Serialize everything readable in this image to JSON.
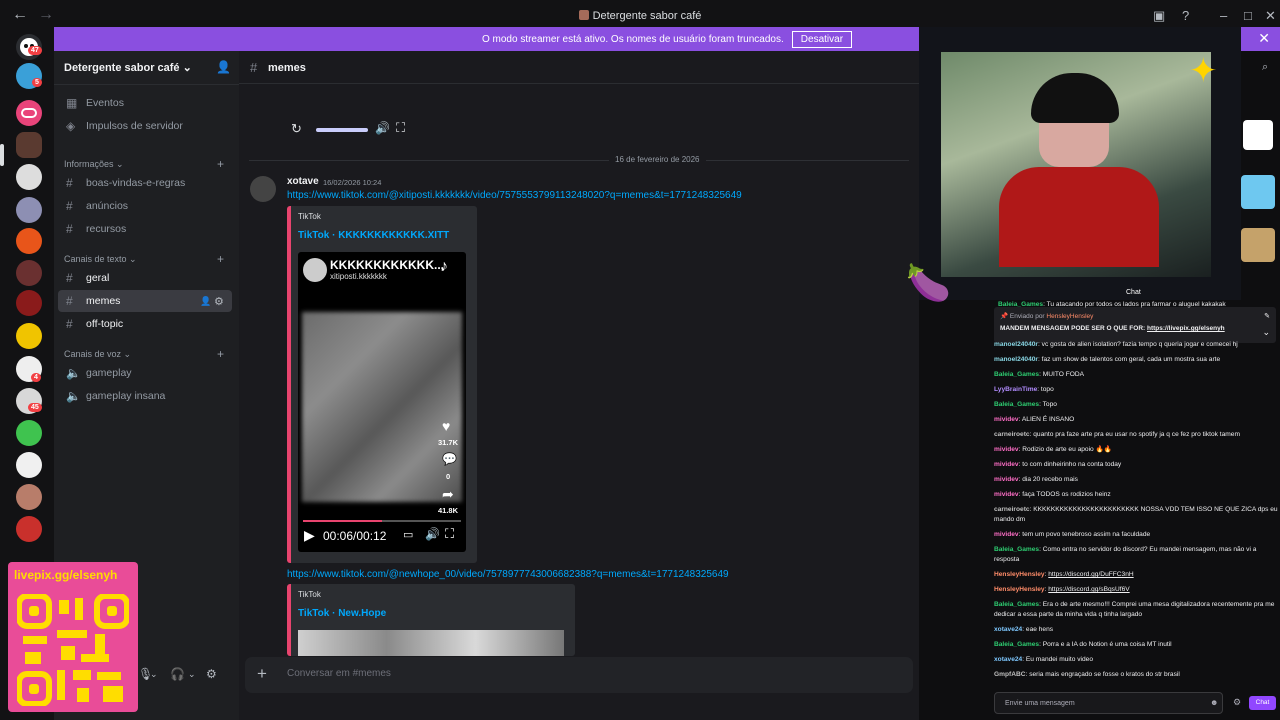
{
  "window": {
    "title": "Detergente sabor café"
  },
  "banner": {
    "text": "O modo streamer está ativo. Os nomes de usuário foram truncados.",
    "button": "Desativar"
  },
  "servers": {
    "badges": [
      "47",
      "5",
      "4",
      "45"
    ]
  },
  "sidebar": {
    "server_name": "Detergente sabor café",
    "top_items": [
      {
        "label": "Eventos"
      },
      {
        "label": "Impulsos de servidor"
      }
    ],
    "categories": {
      "info": "Informações",
      "text": "Canais de texto",
      "voice": "Canais de voz"
    },
    "info_channels": [
      "boas-vindas-e-regras",
      "anúncios",
      "recursos"
    ],
    "text_channels": [
      "geral",
      "memes",
      "off-topic"
    ],
    "voice_channels": [
      "gameplay",
      "gameplay insana"
    ]
  },
  "channel": {
    "name": "memes",
    "date_divider": "16 de fevereiro de 2026",
    "input_placeholder": "Conversar em #memes"
  },
  "message": {
    "author": "xotave",
    "timestamp": "16/02/2026 10:24",
    "link1": "https://www.tiktok.com/@xitiposti.kkkkkkk/video/7575553799113248020?q=memes&t=1771248325649",
    "embed1": {
      "provider": "TikTok",
      "title": "TikTok · KKKKKKKKKKKK.XITT",
      "video_title": "KKKKKKKKKKKK...",
      "video_user": "xitiposti.kkkkkkk",
      "likes": "31.7K",
      "comments": "0",
      "shares": "41.8K",
      "time": "00:06/00:12",
      "progress": 0.5
    },
    "link2": "https://www.tiktok.com/@newhope_00/video/7578977743006682388?q=memes&t=1771248325649",
    "embed2": {
      "provider": "TikTok",
      "title": "TikTok · New.Hope"
    }
  },
  "overlay": {
    "qr_url": "livepix.gg/elsenyh",
    "cam_label": "Chat"
  },
  "chat": {
    "pinned_by_prefix": "Enviado por",
    "pinned_by_user": "HensleyHensley",
    "pinned_text": "MANDEM MENSAGEM PODE SER O QUE FOR:",
    "pinned_link": "https://livepix.gg/elsenyh",
    "top_partial": {
      "user": "Baleia_Games",
      "text": "Tu atacando por todos os lados pra farmar o aluguel kakakak",
      "color": "#2ecc71"
    },
    "messages": [
      {
        "user": "manoel24040r",
        "text": "vc gosta de alien isolation? fazia tempo q queria jogar e comecei hj",
        "color": "#8ad8e6"
      },
      {
        "user": "manoel24040r",
        "text": "faz um show de talentos com geral, cada um mostra sua arte",
        "color": "#8ad8e6"
      },
      {
        "user": "Baleia_Games",
        "text": "MUITO FODA",
        "color": "#2ecc71"
      },
      {
        "user": "LyyBrainTime",
        "text": "topo",
        "color": "#b28cff"
      },
      {
        "user": "Baleia_Games",
        "text": "Topo",
        "color": "#2ecc71"
      },
      {
        "user": "mividev",
        "text": "ALIEN É INSANO",
        "color": "#ff6ec7"
      },
      {
        "user": "carneiroetc",
        "text": "quanto pra faze arte pra eu usar no spotify ja q ce fez pro tiktok tamem",
        "color": "#c0c0c0"
      },
      {
        "user": "mividev",
        "text": "Rodizio de arte eu apoio 🔥🔥",
        "color": "#ff6ec7"
      },
      {
        "user": "mividev",
        "text": "to com dinheirinho na conta today",
        "color": "#ff6ec7"
      },
      {
        "user": "mividev",
        "text": "dia 20 recebo mais",
        "color": "#ff6ec7"
      },
      {
        "user": "mividev",
        "text": "faça TODOS os rodizios heinz",
        "color": "#ff6ec7"
      },
      {
        "user": "carneiroetc",
        "text": "KKKKKKKKKKKKKKKKKKKKKKKK NOSSA VDD TEM ISSO NE QUE ZICA dps eu mando dm",
        "color": "#c0c0c0"
      },
      {
        "user": "mividev",
        "text": "tem um povo tenebroso assim na faculdade",
        "color": "#ff6ec7"
      },
      {
        "user": "Baleia_Games",
        "text": "Como entra no servidor do discord? Eu mandei mensagem, mas não vi a resposta",
        "color": "#2ecc71"
      },
      {
        "user": "HensleyHensley",
        "text": "https://discord.gg/DuFFC3nH",
        "color": "#ff8c69",
        "link": true
      },
      {
        "user": "HensleyHensley",
        "text": "https://discord.gg/sBqsUf6V",
        "color": "#ff8c69",
        "link": true
      },
      {
        "user": "Baleia_Games",
        "text": "Era o de arte mesmo!!! Comprei uma mesa digitalizadora recentemente pra me dedicar a essa parte da minha vida q tinha largado",
        "color": "#2ecc71"
      },
      {
        "user": "xotave24",
        "text": "eae hens",
        "color": "#7ec8ff"
      },
      {
        "user": "Baleia_Games",
        "text": "Porra e a IA do Notion é uma coisa MT inutil",
        "color": "#2ecc71"
      },
      {
        "user": "xotave24",
        "text": "Eu mandei muito video",
        "color": "#7ec8ff"
      },
      {
        "user": "GmpfABC",
        "text": "seria mais engraçado se fosse o kratos do str brasil",
        "color": "#c0c0c0"
      }
    ],
    "input_placeholder": "Envie uma mensagem",
    "send_button": "Chat"
  }
}
